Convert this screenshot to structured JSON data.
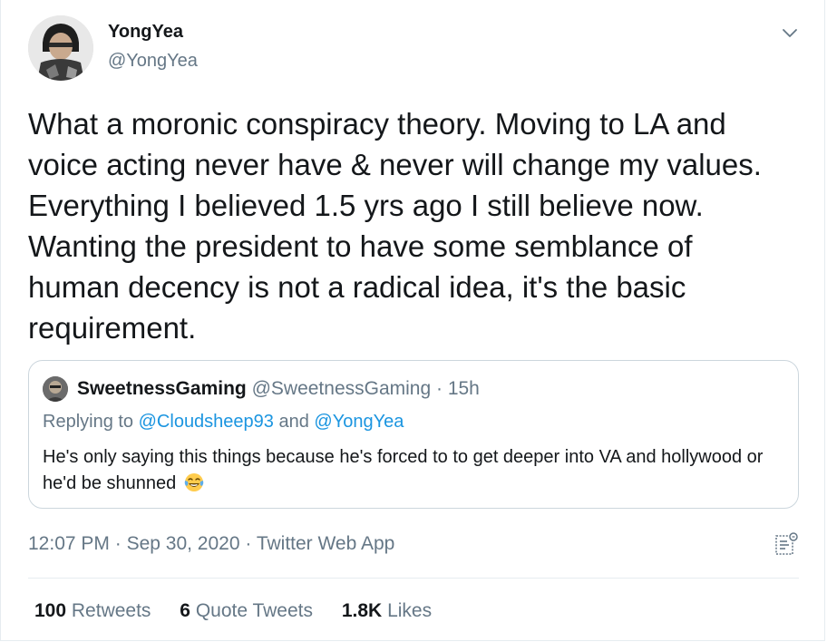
{
  "tweet": {
    "display_name": "YongYea",
    "handle": "@YongYea",
    "text": "What a moronic conspiracy theory. Moving to LA and\nvoice acting never have & never will change my values.\nEverything I believed 1.5 yrs ago I still believe now.\nWanting the president to have some semblance of\nhuman decency is not a radical idea, it's the basic\nrequirement.",
    "more_icon": "chevron-down-icon"
  },
  "quoted": {
    "display_name": "SweetnessGaming",
    "handle": "@SweetnessGaming",
    "separator": " · ",
    "time": "15h",
    "replying_prefix": "Replying to ",
    "reply_mention_1": "@Cloudsheep93",
    "reply_and": " and ",
    "reply_mention_2": "@YongYea",
    "text": "He's only saying this things because he's forced to to get deeper into VA and hollywood or he'd be shunned ",
    "emoji": "face-with-tears-of-joy-emoji"
  },
  "meta": {
    "time": "12:07 PM",
    "separator": " · ",
    "date": "Sep 30, 2020",
    "source": "Twitter Web App",
    "analytics_icon": "analytics-icon"
  },
  "stats": {
    "retweets_count": "100",
    "retweets_label": "Retweets",
    "quotes_count": "6",
    "quotes_label": "Quote Tweets",
    "likes_count": "1.8K",
    "likes_label": "Likes"
  },
  "colors": {
    "text": "#14171a",
    "secondary": "#657786",
    "link": "#1b95e0",
    "border": "#ccd6dd"
  }
}
